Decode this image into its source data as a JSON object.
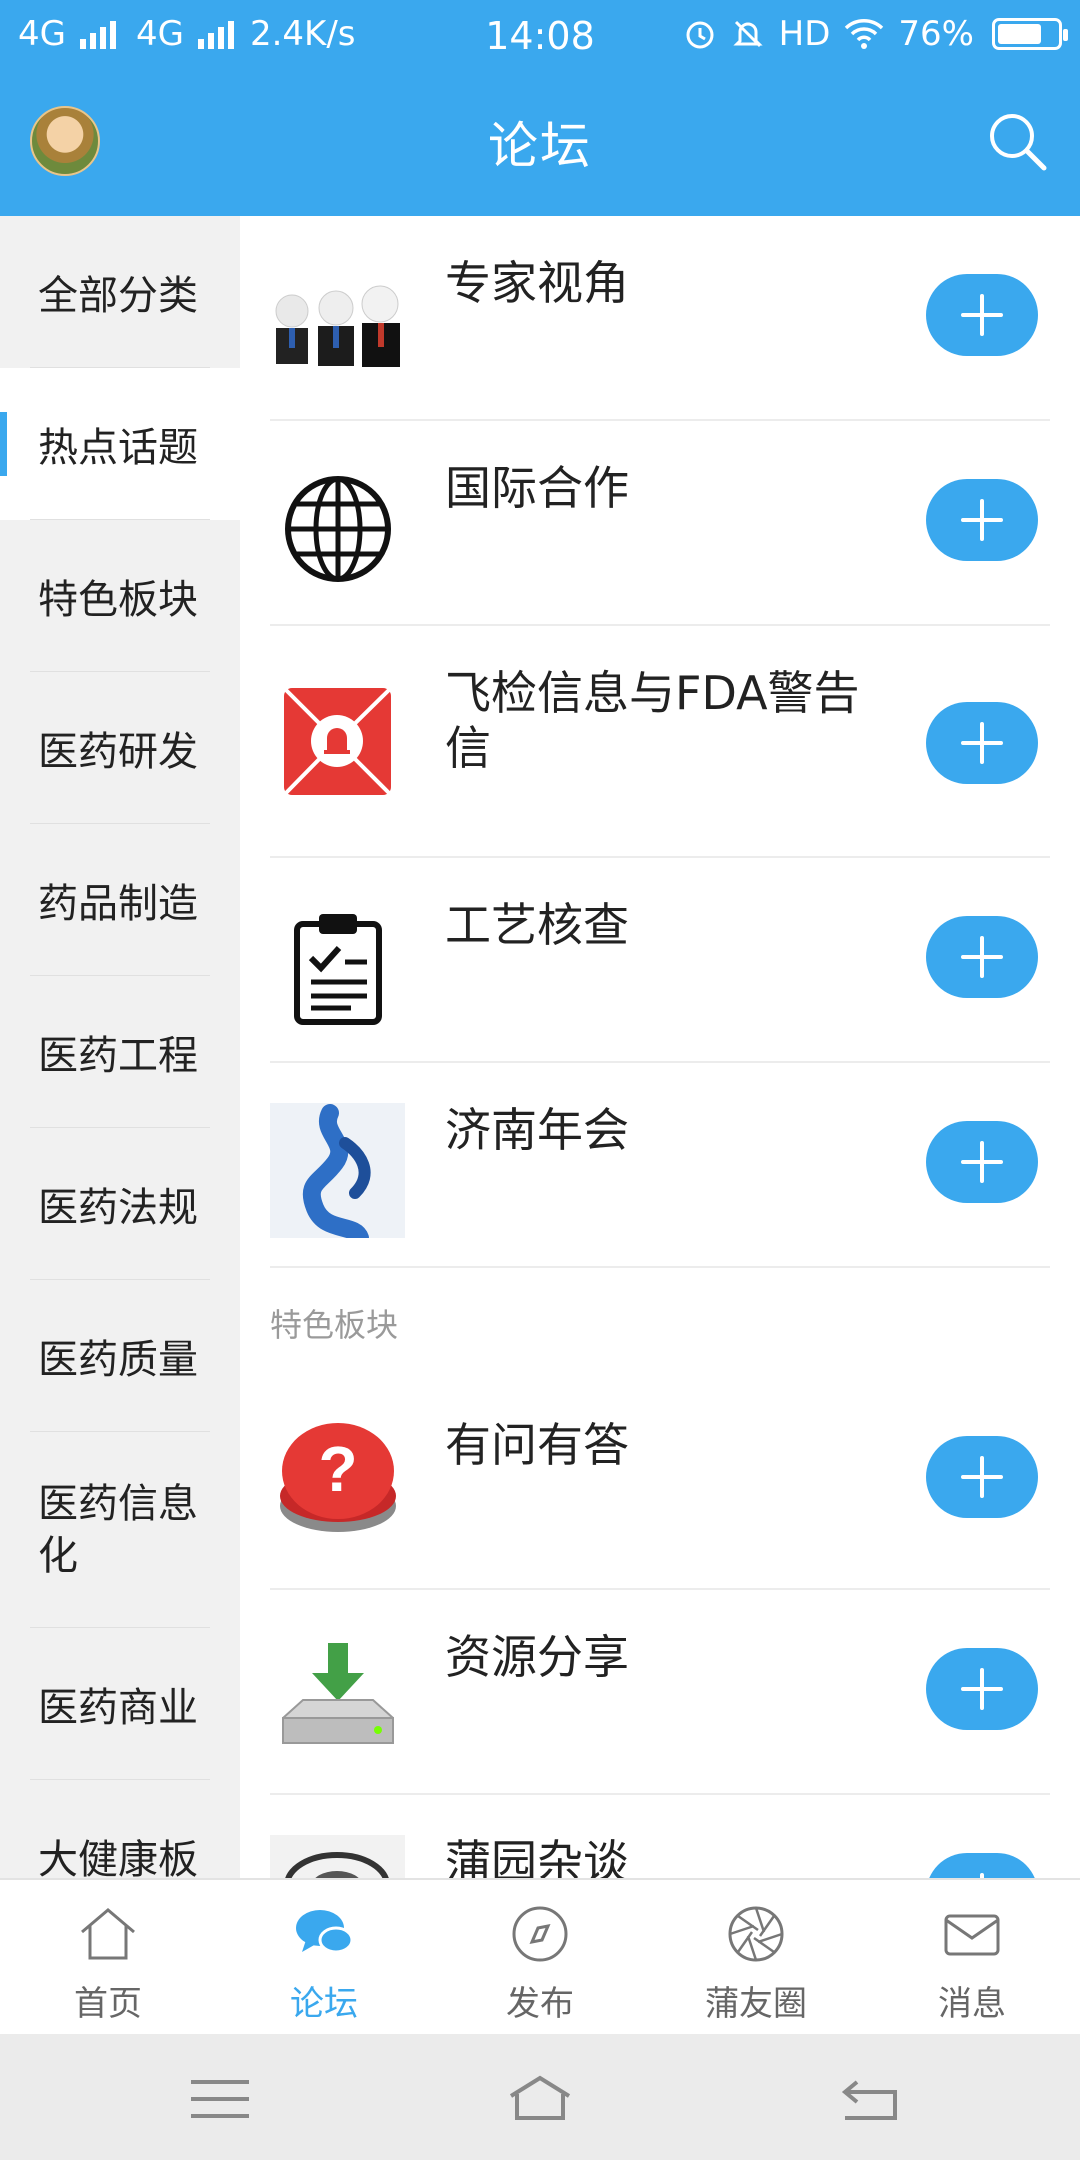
{
  "status": {
    "left": "4G 4G",
    "net1": "4G",
    "net2": "4G",
    "speed": "2.4K/s",
    "time": "14:08",
    "hd": "HD",
    "battery_percent": "76%",
    "battery_level": 0.76
  },
  "header": {
    "title": "论坛"
  },
  "sidebar": {
    "items": [
      {
        "label": "全部分类",
        "active": false
      },
      {
        "label": "热点话题",
        "active": true
      },
      {
        "label": "特色板块",
        "active": false
      },
      {
        "label": "医药研发",
        "active": false
      },
      {
        "label": "药品制造",
        "active": false
      },
      {
        "label": "医药工程",
        "active": false
      },
      {
        "label": "医药法规",
        "active": false
      },
      {
        "label": "医药质量",
        "active": false
      },
      {
        "label": "医药信息化",
        "active": false
      },
      {
        "label": "医药商业",
        "active": false
      },
      {
        "label": "大健康板",
        "active": false
      }
    ]
  },
  "content": {
    "hot": [
      {
        "name": "专家视角",
        "icon": "experts-icon"
      },
      {
        "name": "国际合作",
        "icon": "globe-icon"
      },
      {
        "name": "飞检信息与FDA警告信",
        "icon": "alarm-icon"
      },
      {
        "name": "工艺核查",
        "icon": "clipboard-icon"
      },
      {
        "name": "济南年会",
        "icon": "ribbon-sculpture-icon"
      }
    ],
    "section_title": "特色板块",
    "featured": [
      {
        "name": "有问有答",
        "icon": "question-button-icon"
      },
      {
        "name": "资源分享",
        "icon": "download-drive-icon"
      },
      {
        "name": "蒲园杂谈",
        "icon": "sketch-icon"
      }
    ]
  },
  "tabs": [
    {
      "label": "首页",
      "icon": "home-icon",
      "active": false
    },
    {
      "label": "论坛",
      "icon": "chat-bubbles-icon",
      "active": true
    },
    {
      "label": "发布",
      "icon": "compass-icon",
      "active": false
    },
    {
      "label": "蒲友圈",
      "icon": "aperture-icon",
      "active": false
    },
    {
      "label": "消息",
      "icon": "mail-icon",
      "active": false
    }
  ],
  "colors": {
    "accent": "#3aa8ee",
    "sidebar_bg": "#f1f1f1"
  }
}
